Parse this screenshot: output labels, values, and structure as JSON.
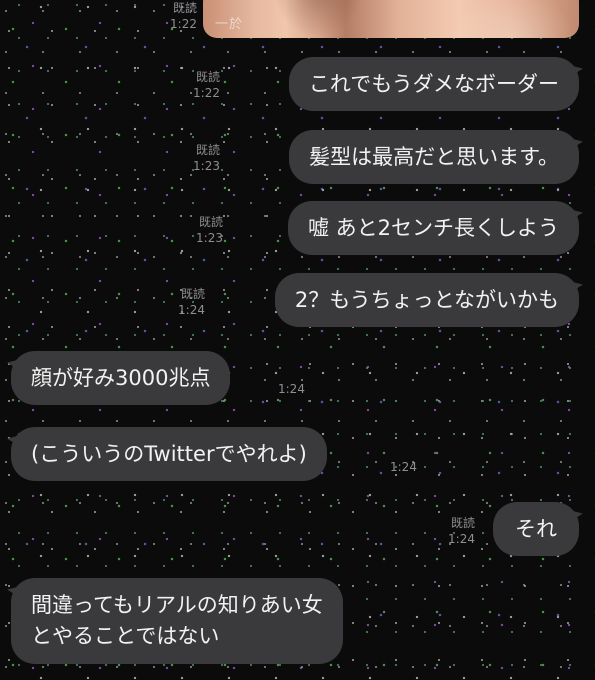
{
  "messages": [
    {
      "side": "out",
      "type": "image",
      "read": "既読",
      "time": "1:22",
      "watermark": "一於"
    },
    {
      "side": "out",
      "text": "これでもうダメなボーダー",
      "read": "既読",
      "time": "1:22"
    },
    {
      "side": "out",
      "text": "髪型は最高だと思います。",
      "read": "既読",
      "time": "1:23"
    },
    {
      "side": "out",
      "text": "嘘 あと2センチ長くしよう",
      "read": "既読",
      "time": "1:23"
    },
    {
      "side": "out",
      "text": "2？もうちょっとながいかも",
      "read": "既読",
      "time": "1:24"
    },
    {
      "side": "in",
      "text": "顔が好み3000兆点",
      "time": "1:24"
    },
    {
      "side": "in",
      "text": "(こういうのTwitterでやれよ)",
      "time": "1:24"
    },
    {
      "side": "out",
      "text": "それ",
      "read": "既読",
      "time": "1:24"
    },
    {
      "side": "in",
      "text": "間違ってもリアルの知りあい女\nとやることではない",
      "time": ""
    }
  ],
  "colors": {
    "background": "#0b0b0b",
    "bubble": "#3a3a3c",
    "text": "#f2f2f2",
    "meta": "#8e8e93"
  }
}
